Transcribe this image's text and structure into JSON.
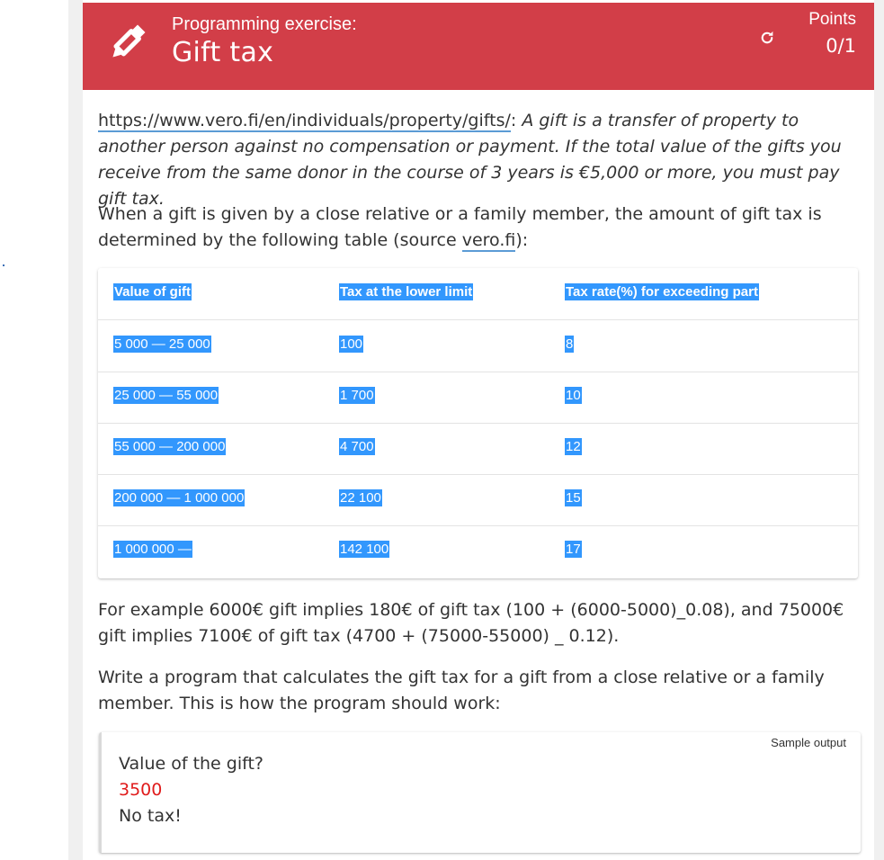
{
  "header": {
    "subtitle": "Programming exercise:",
    "title": "Gift tax",
    "points_label": "Points",
    "points_value": "0/1",
    "icons": {
      "exercise": "pencil-icon",
      "reload": "reload-icon"
    },
    "colors": {
      "background": "#d23e48",
      "text": "#ffffff"
    }
  },
  "intro": {
    "link": "https://www.vero.fi/en/individuals/property/gifts/",
    "colon": ":",
    "quote": " A gift is a transfer of property to another person against no compensation or payment. If the total value of the gifts you receive from the same donor in the course of 3 years is €5,000 or more, you must pay gift tax."
  },
  "relative_text": {
    "before": "When a gift is given by a close relative or a family member, the amount of gift tax is determined by the following table (source ",
    "link": "vero.fi",
    "after": "):"
  },
  "table": {
    "headers": [
      "Value of gift",
      "Tax at the lower limit",
      "Tax rate(%) for exceeding part"
    ],
    "rows": [
      [
        "5 000 — 25 000",
        "100",
        "8"
      ],
      [
        "25 000 — 55 000",
        "1 700",
        "10"
      ],
      [
        "55 000 — 200 000",
        "4 700",
        "12"
      ],
      [
        "200 000 — 1 000 000",
        "22 100",
        "15"
      ],
      [
        "1 000 000 —",
        "142 100",
        "17"
      ]
    ],
    "selection_color": "#3297fd"
  },
  "example_text": "For example 6000€ gift implies 180€ of gift tax (100 + (6000-5000)_0.08), and 75000€ gift implies 7100€ of gift tax (4700 + (75000-55000) _ 0.12).",
  "write_text": "Write a program that calculates the gift tax for a gift from a close relative or a family member. This is how the program should work:",
  "sample": {
    "label": "Sample output",
    "lines": [
      "Value of the gift?",
      "3500",
      "No tax!"
    ],
    "input_color": "#e01b1b"
  }
}
